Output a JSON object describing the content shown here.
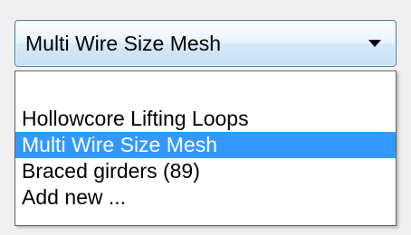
{
  "combo": {
    "selected_value": "Multi Wire Size Mesh",
    "arrow_icon": "triangle-down-icon"
  },
  "dropdown": {
    "items": [
      {
        "label": ""
      },
      {
        "label": "Hollowcore Lifting Loops"
      },
      {
        "label": "Multi Wire Size Mesh",
        "selected": true
      },
      {
        "label": "Braced girders (89)"
      },
      {
        "label": "Add new ..."
      }
    ],
    "highlight_color": "#3399ff"
  }
}
